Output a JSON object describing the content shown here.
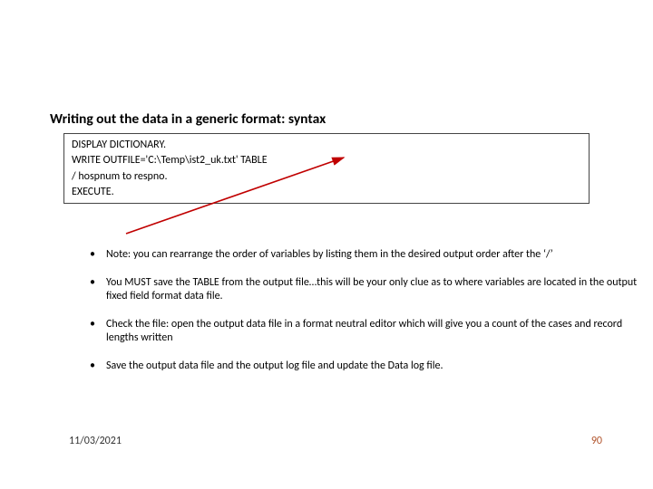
{
  "title": "Writing out the data in a generic format: syntax",
  "code": {
    "line1": "DISPLAY DICTIONARY.",
    "line2": "WRITE OUTFILE='C:\\Temp\\ist2_uk.txt' TABLE",
    "line3": " / hospnum to respno.",
    "line4": "EXECUTE."
  },
  "bullets": {
    "b1": "Note: you can rearrange the order of variables by listing them in the desired output order after the ‘/’",
    "b2": "You MUST save the TABLE from the output file…this will be your only clue as to where variables are located in the output fixed field format data file.",
    "b3": "Check the file: open the output data file in a format neutral editor which will give you a count of the cases and record lengths written",
    "b4": "Save the output data file and the output log file and update the Data log file."
  },
  "footer": {
    "date": "11/03/2021",
    "page": "90"
  }
}
